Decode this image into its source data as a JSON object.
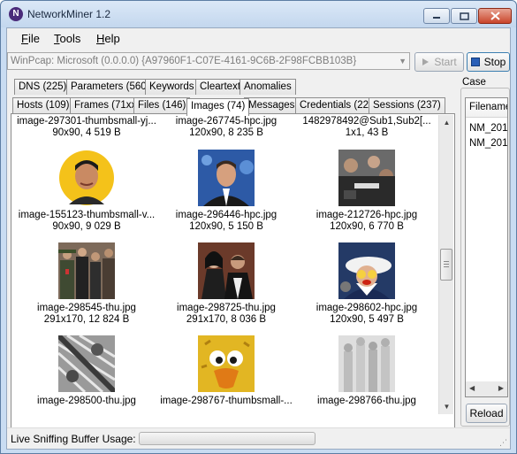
{
  "window": {
    "title": "NetworkMiner 1.2"
  },
  "menu": [
    {
      "label": "File",
      "accel": "F",
      "rest": "ile"
    },
    {
      "label": "Tools",
      "accel": "T",
      "rest": "ools"
    },
    {
      "label": "Help",
      "accel": "H",
      "rest": "elp"
    }
  ],
  "toolbar": {
    "interface_value": "WinPcap: Microsoft (0.0.0.0) {A97960F1-C07E-4161-9C6B-2F98FCBB103B}",
    "start_label": "Start",
    "stop_label": "Stop"
  },
  "tabs_row1": [
    "DNS (225)",
    "Parameters (560)",
    "Keywords",
    "Cleartext",
    "Anomalies"
  ],
  "tabs_row2": [
    "Hosts (109)",
    "Frames (71xx)",
    "Files (146)",
    "Images (74)",
    "Messages",
    "Credentials (22)",
    "Sessions (237)"
  ],
  "active_tab": "Images (74)",
  "images": [
    {
      "name": "image-297301-thumbsmall-yj...",
      "info": "90x90, 4 519 B",
      "thumb": "none"
    },
    {
      "name": "image-267745-hpc.jpg",
      "info": "120x90, 8 235 B",
      "thumb": "none"
    },
    {
      "name": "1482978492@Sub1,Sub2[...",
      "info": "1x1, 43 B",
      "thumb": "none"
    },
    {
      "name": "image-155123-thumbsmall-v...",
      "info": "90x90, 9 029 B",
      "thumb": "portrait-round"
    },
    {
      "name": "image-296446-hpc.jpg",
      "info": "120x90, 5 150 B",
      "thumb": "man-suit-blue"
    },
    {
      "name": "image-212726-hpc.jpg",
      "info": "120x90, 6 770 B",
      "thumb": "crowd-press"
    },
    {
      "name": "image-298545-thu.jpg",
      "info": "291x170, 12 824 B",
      "thumb": "military-group"
    },
    {
      "name": "image-298725-thu.jpg",
      "info": "291x170, 8 036 B",
      "thumb": "couple-event"
    },
    {
      "name": "image-298602-hpc.jpg",
      "info": "120x90, 5 497 B",
      "thumb": "costume-sailor"
    },
    {
      "name": "image-298500-thu.jpg",
      "info": "",
      "thumb": "bw-crowd"
    },
    {
      "name": "image-298767-thumbsmall-...",
      "info": "",
      "thumb": "yellow-bird"
    },
    {
      "name": "image-298766-thu.jpg",
      "info": "",
      "thumb": "gray-statues"
    }
  ],
  "case_panel": {
    "legend": "Case",
    "column": "Filename",
    "rows": [
      "NM_201",
      "NM_201"
    ],
    "reload_label": "Reload"
  },
  "status": {
    "label": "Live Sniffing Buffer Usage:"
  },
  "colors": {
    "stop_blue": "#2a5fb7",
    "frame": "#c9dcf2",
    "close_red": "#c9452b"
  }
}
